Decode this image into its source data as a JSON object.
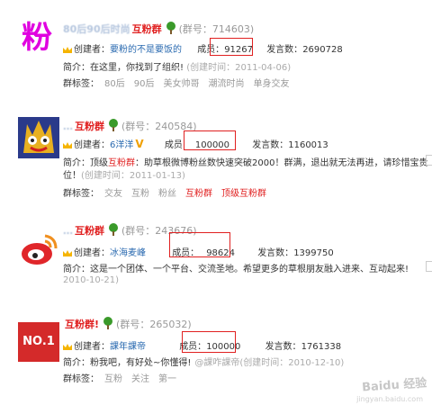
{
  "labels": {
    "creator": "创建者：",
    "members": "成员：",
    "members_plain": "成员",
    "posts": "发言数：",
    "intro": "简介：",
    "created_open": "(创建时间：",
    "tags": "群标签："
  },
  "groups": [
    {
      "avatar_char": "粉",
      "title_prefix": "80后90后时尚",
      "title_name": "互粉群",
      "group_id": "(群号：714603)",
      "creator": "要粉的不是要饭的",
      "members": "91267",
      "posts": "2690728",
      "intro": "在这里，你找到了组织!",
      "created": "2011-04-06)",
      "tags": [
        "80后",
        "90后",
        "美女帅哥",
        "潮流时尚",
        "单身交友"
      ]
    },
    {
      "title_prefix": "…",
      "title_name": "互粉群",
      "group_id": "(群号：240584)",
      "creator": "6洋洋",
      "members": "100000",
      "posts": "1160013",
      "intro_prefix": "顶级",
      "intro_red": "互粉群",
      "intro_rest": "：助草根微博粉丝数快速突破2000！群满，退出就无法再进，请珍惜宝贵",
      "intro_line2": "位！",
      "created": "2011-01-13)",
      "tags": [
        "交友",
        "互粉",
        "粉丝",
        "互粉群",
        "顶级互粉群"
      ]
    },
    {
      "title_prefix": "…",
      "title_name": "互粉群",
      "group_id": "(群号：243676)",
      "creator": "冰海麦峰",
      "members": "98624",
      "posts": "1399750",
      "intro": "这是一个团体、一个平台、交流圣地。希望更多的草根朋友融入进来、互动起来!",
      "created": "2010-10-21)"
    },
    {
      "avatar_text": "NO.1",
      "title_name": "互粉群!",
      "group_id": "(群号：265032)",
      "creator": "課年課帝",
      "members": "100000",
      "posts": "1761338",
      "intro": "粉我吧，有好处~你懂得!",
      "intro_creator": "@課咋課帝",
      "created": "2010-12-10)",
      "tags": [
        "互粉",
        "关注",
        "第一"
      ]
    }
  ],
  "watermark": "Baidu 经验",
  "watermark_url": "jingyan.baidu.com",
  "colors": {
    "accent_red": "#e02020",
    "link_blue": "#2a6ab0",
    "muted": "#999999"
  }
}
